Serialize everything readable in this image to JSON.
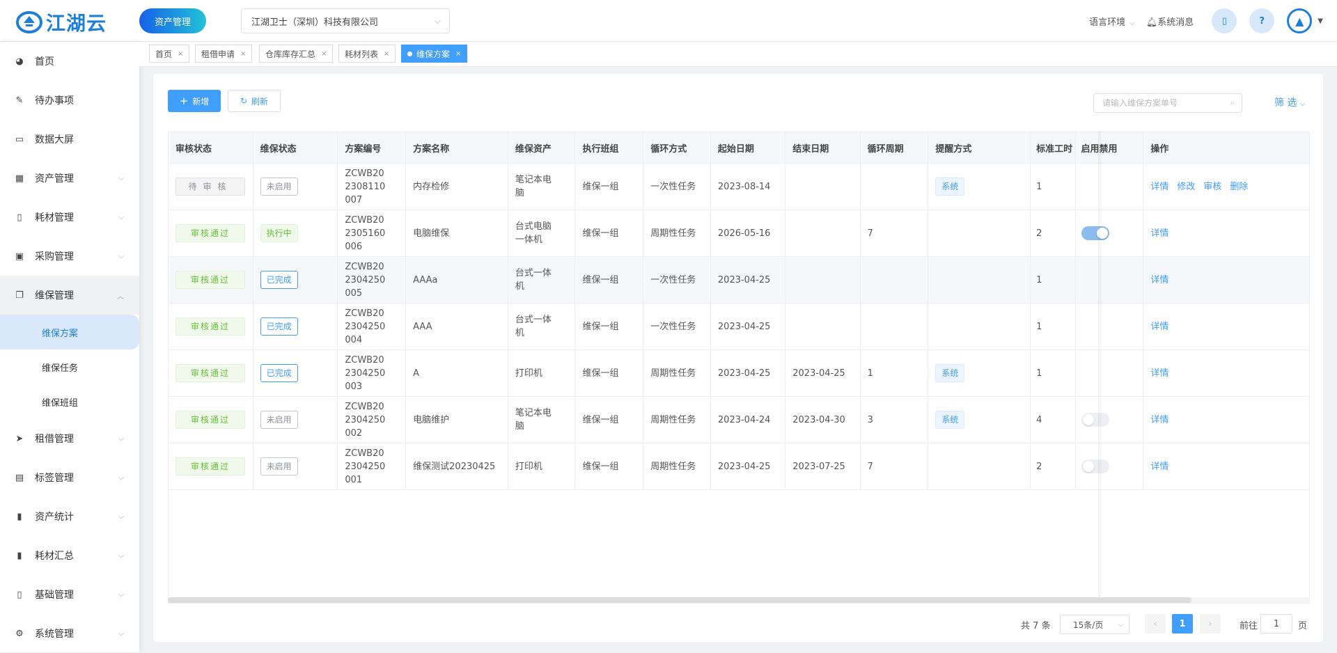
{
  "header": {
    "logo_text": "江湖云",
    "module_button": "资产管理",
    "company": "江湖卫士（深圳）科技有限公司",
    "language": "语言环境",
    "messages": "系统消息"
  },
  "sidebar": {
    "items": [
      {
        "label": "首页",
        "icon": "dashboard-icon"
      },
      {
        "label": "待办事项",
        "icon": "edit-icon"
      },
      {
        "label": "数据大屏",
        "icon": "monitor-icon"
      },
      {
        "label": "资产管理",
        "icon": "grid-icon"
      },
      {
        "label": "耗材管理",
        "icon": "book-icon"
      },
      {
        "label": "采购管理",
        "icon": "cart-icon"
      },
      {
        "label": "维保管理",
        "icon": "copy-icon"
      },
      {
        "label": "租借管理",
        "icon": "send-icon"
      },
      {
        "label": "标签管理",
        "icon": "print-icon"
      },
      {
        "label": "资产统计",
        "icon": "bar-chart-icon"
      },
      {
        "label": "耗材汇总",
        "icon": "bar-chart-icon"
      },
      {
        "label": "基础管理",
        "icon": "book-icon"
      },
      {
        "label": "系统管理",
        "icon": "gear-icon"
      }
    ],
    "sub_items": [
      "维保方案",
      "维保任务",
      "维保班组"
    ]
  },
  "tabs": [
    "首页",
    "租借申请",
    "仓库库存汇总",
    "耗材列表",
    "维保方案"
  ],
  "toolbar": {
    "add_label": "新增",
    "refresh_label": "刷新",
    "search_placeholder": "请输入维保方案单号",
    "filter_label": "筛 选"
  },
  "table": {
    "columns": [
      "审核状态",
      "维保状态",
      "方案编号",
      "方案名称",
      "维保资产",
      "执行班组",
      "循环方式",
      "起始日期",
      "结束日期",
      "循环周期",
      "提醒方式",
      "标准工时",
      "启用禁用",
      "操作"
    ],
    "rows": [
      {
        "audit": "待审核",
        "audit_type": "pend",
        "status": "未启用",
        "status_type": "off",
        "code": "ZCWB202308110007",
        "name": "内存检修",
        "asset": "笔记本电脑",
        "team": "维保一组",
        "cycle": "一次性任务",
        "start": "2023-08-14",
        "end": "",
        "period": "",
        "remind": "系统",
        "hours": "1",
        "switch": "none",
        "ops": [
          "详情",
          "修改",
          "审核",
          "删除"
        ]
      },
      {
        "audit": "审核通过",
        "audit_type": "ok",
        "status": "执行中",
        "status_type": "run",
        "code": "ZCWB202305160006",
        "name": "电脑维保",
        "asset": "台式电脑一体机",
        "team": "维保一组",
        "cycle": "周期性任务",
        "start": "2026-05-16",
        "end": "",
        "period": "7",
        "remind": "",
        "hours": "2",
        "switch": "on",
        "ops": [
          "详情"
        ]
      },
      {
        "audit": "审核通过",
        "audit_type": "ok",
        "status": "已完成",
        "status_type": "done",
        "code": "ZCWB202304250005",
        "name": "AAAa",
        "asset": "台式一体机",
        "team": "维保一组",
        "cycle": "一次性任务",
        "start": "2023-04-25",
        "end": "",
        "period": "",
        "remind": "",
        "hours": "1",
        "switch": "none",
        "ops": [
          "详情"
        ]
      },
      {
        "audit": "审核通过",
        "audit_type": "ok",
        "status": "已完成",
        "status_type": "done",
        "code": "ZCWB202304250004",
        "name": "AAA",
        "asset": "台式一体机",
        "team": "维保一组",
        "cycle": "一次性任务",
        "start": "2023-04-25",
        "end": "",
        "period": "",
        "remind": "",
        "hours": "1",
        "switch": "none",
        "ops": [
          "详情"
        ]
      },
      {
        "audit": "审核通过",
        "audit_type": "ok",
        "status": "已完成",
        "status_type": "done",
        "code": "ZCWB202304250003",
        "name": "A",
        "asset": "打印机",
        "team": "维保一组",
        "cycle": "周期性任务",
        "start": "2023-04-25",
        "end": "2023-04-25",
        "period": "1",
        "remind": "系统",
        "hours": "1",
        "switch": "none",
        "ops": [
          "详情"
        ]
      },
      {
        "audit": "审核通过",
        "audit_type": "ok",
        "status": "未启用",
        "status_type": "off",
        "code": "ZCWB202304250002",
        "name": "电脑维护",
        "asset": "笔记本电脑",
        "team": "维保一组",
        "cycle": "周期性任务",
        "start": "2023-04-24",
        "end": "2023-04-30",
        "period": "3",
        "remind": "系统",
        "hours": "4",
        "switch": "off",
        "ops": [
          "详情"
        ]
      },
      {
        "audit": "审核通过",
        "audit_type": "ok",
        "status": "未启用",
        "status_type": "off",
        "code": "ZCWB202304250001",
        "name": "维保测试20230425",
        "asset": "打印机",
        "team": "维保一组",
        "cycle": "周期性任务",
        "start": "2023-04-25",
        "end": "2023-07-25",
        "period": "7",
        "remind": "",
        "hours": "2",
        "switch": "off",
        "ops": [
          "详情"
        ]
      }
    ]
  },
  "pagination": {
    "total": "共 7 条",
    "page_size": "15条/页",
    "current_page": "1",
    "goto_label": "前往",
    "goto_value": "1",
    "page_label": "页"
  },
  "colors": {
    "primary": "#409eff",
    "success": "#67c23a",
    "brand": "#1e7fd6"
  }
}
